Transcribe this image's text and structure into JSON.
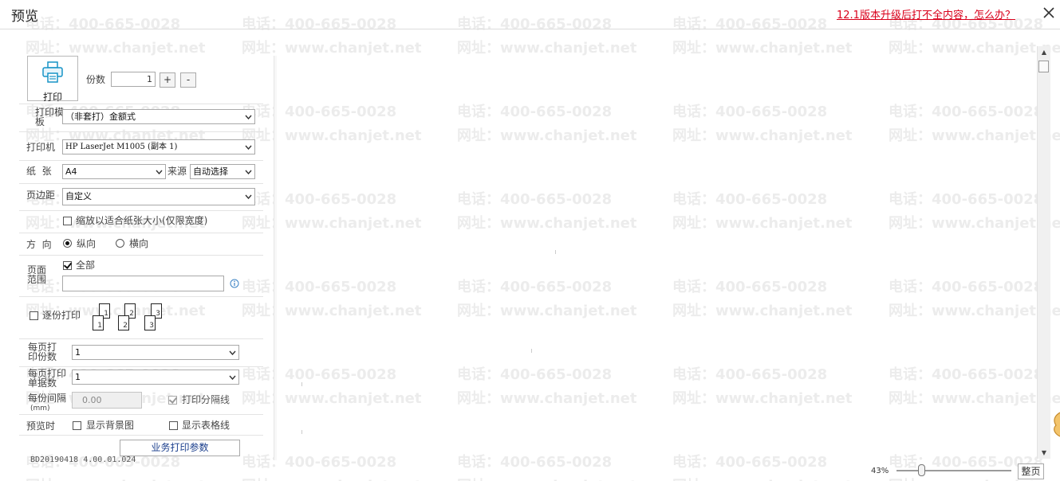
{
  "window": {
    "title": "预览",
    "upgrade_link": "12.1版本升级后打不全内容，怎么办？",
    "close_icon": "close-icon"
  },
  "watermark": {
    "phone": "电话：400-665-0028",
    "site": "网址：www.chanjet.net"
  },
  "print_button": {
    "label": "打印",
    "icon": "printer-icon"
  },
  "copies": {
    "label": "份数",
    "value": "1",
    "plus": "+",
    "minus": "-"
  },
  "template": {
    "label": "打印模板",
    "value": "（非套打）金额式"
  },
  "printer": {
    "label": "打印机",
    "value": "HP LaserJet M1005 (副本 1)"
  },
  "paper": {
    "label": "纸  张",
    "value": "A4",
    "source_label": "来源",
    "source_value": "自动选择"
  },
  "margin": {
    "label": "页边距",
    "value": "自定义"
  },
  "scale": {
    "label": "缩放以适合纸张大小(仅限宽度)",
    "checked": false
  },
  "orientation": {
    "label": "方  向",
    "portrait": "纵向",
    "landscape": "横向",
    "selected": "portrait"
  },
  "page_range": {
    "label": "页面范围",
    "all_label": "全部",
    "all_checked": true,
    "input_value": "",
    "info_icon": "info-icon"
  },
  "collate": {
    "label": "逐份打印",
    "checked": false,
    "pages": [
      "1",
      "2",
      "3"
    ]
  },
  "copies_per_page": {
    "label": "每页打印份数",
    "value": "1"
  },
  "docs_per_page": {
    "label": "每页打印单据数",
    "value": "1"
  },
  "copy_gap": {
    "label": "每份间隔",
    "unit": "(mm)",
    "value": "0.00",
    "separator_label": "打印分隔线",
    "separator_checked": true
  },
  "preview_opts": {
    "label": "预览时",
    "background_label": "显示背景图",
    "background_checked": false,
    "grid_label": "显示表格线",
    "grid_checked": false
  },
  "business_params_button": "业务打印参数",
  "version": "BD20190418 4.00.01.024",
  "zoom": {
    "value": "43%",
    "level": 0.2,
    "fit_button": "整页"
  }
}
